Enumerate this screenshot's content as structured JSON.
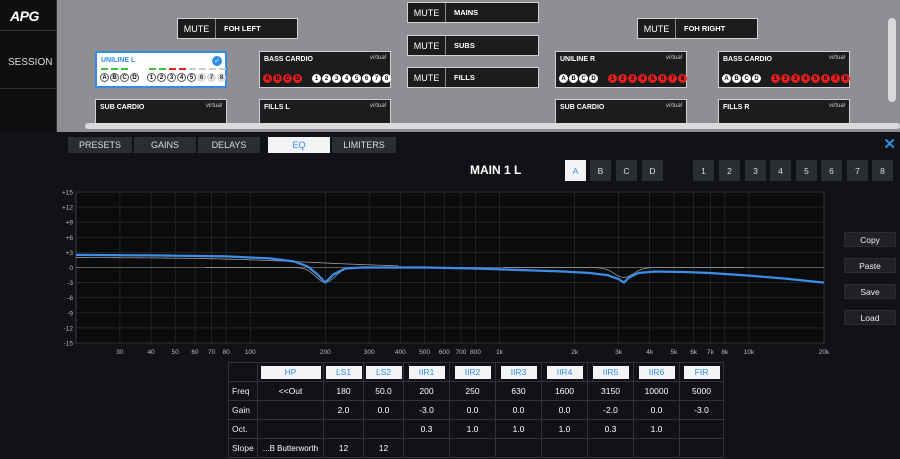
{
  "app": {
    "logo": "APG",
    "session": "SESSION"
  },
  "patch": {
    "mutes": [
      {
        "mute": "MUTE",
        "name": "FOH LEFT"
      },
      {
        "mute": "MUTE",
        "name": "MAINS"
      },
      {
        "mute": "MUTE",
        "name": "SUBS"
      },
      {
        "mute": "MUTE",
        "name": "FILLS"
      },
      {
        "mute": "MUTE",
        "name": "FOH RIGHT"
      }
    ],
    "channels": [
      {
        "title": "UNILINE L",
        "virtual": "",
        "selected": true
      },
      {
        "title": "BASS CARDIO",
        "virtual": "virtual"
      },
      {
        "title": "UNILINE R",
        "virtual": "virtual"
      },
      {
        "title": "BASS CARDIO",
        "virtual": "virtual"
      },
      {
        "title": "SUB CARDIO",
        "virtual": "virtual"
      },
      {
        "title": "FILLS L",
        "virtual": "virtual"
      },
      {
        "title": "SUB CARDIO",
        "virtual": "virtual"
      },
      {
        "title": "FILLS R",
        "virtual": "virtual"
      }
    ],
    "abcd": [
      "A",
      "B",
      "C",
      "D"
    ],
    "nums": [
      "1",
      "2",
      "3",
      "4",
      "5",
      "6",
      "7",
      "8"
    ]
  },
  "tabs": [
    "PRESETS",
    "GAINS",
    "DELAYS",
    "EQ",
    "LIMITERS"
  ],
  "active_tab": "EQ",
  "eq": {
    "title": "MAIN 1 L",
    "presets": [
      "A",
      "B",
      "C",
      "D"
    ],
    "active_preset": "A",
    "outputs": [
      "1",
      "2",
      "3",
      "4",
      "5",
      "6",
      "7",
      "8"
    ],
    "side_buttons": [
      "Copy",
      "Paste",
      "Save",
      "Load"
    ]
  },
  "chart_data": {
    "type": "line",
    "x_scale": "log",
    "xlim": [
      20,
      20000
    ],
    "ylim": [
      -15,
      15
    ],
    "y_ticks": [
      "+15",
      "+12",
      "+9",
      "+6",
      "+3",
      "0",
      "-3",
      "-6",
      "-9",
      "-12",
      "-15"
    ],
    "x_ticks": [
      30,
      40,
      50,
      60,
      70,
      80,
      100,
      200,
      300,
      400,
      500,
      600,
      700,
      800,
      1000,
      2000,
      3000,
      4000,
      5000,
      6000,
      7000,
      8000,
      10000,
      20000
    ],
    "x_tick_labels": [
      "30",
      "40",
      "50",
      "60",
      "70",
      "80",
      "100",
      "200",
      "300",
      "400",
      "500",
      "600",
      "700",
      "800",
      "1k",
      "2k",
      "3k",
      "4k",
      "5k",
      "6k",
      "7k",
      "8k",
      "10k",
      "20k"
    ],
    "grid": true,
    "colors": {
      "curve": "#3d8ee8",
      "bands": "#9a9a9a",
      "bg": "#0a0b0c"
    },
    "series": [
      {
        "x": [
          20,
          40,
          80,
          120,
          150,
          170,
          185,
          200,
          215,
          240,
          280,
          350,
          500,
          800,
          1200,
          1800,
          2300,
          2700,
          3000,
          3150,
          3300,
          3600,
          4200,
          5500,
          7000,
          10000,
          14000,
          20000
        ],
        "y": [
          2.5,
          2.4,
          2.2,
          1.8,
          1.2,
          0.2,
          -1.3,
          -3.0,
          -1.4,
          -0.2,
          0.0,
          0.0,
          0.0,
          -0.2,
          -0.5,
          -0.8,
          -1.1,
          -1.5,
          -2.3,
          -3.0,
          -2.0,
          -1.1,
          -0.8,
          -0.9,
          -1.1,
          -1.6,
          -2.2,
          -3.0
        ]
      }
    ]
  },
  "filter_table": {
    "headers": [
      "HP",
      "LS1",
      "LS2",
      "IIR1",
      "IIR2",
      "IIR3",
      "IIR4",
      "IIR5",
      "IIR6",
      "FIR"
    ],
    "rows": [
      {
        "label": "Freq",
        "cells": [
          "<<Out",
          "180",
          "50.0",
          "200",
          "250",
          "630",
          "1600",
          "3150",
          "10000",
          "5000"
        ]
      },
      {
        "label": "Gain",
        "cells": [
          "",
          "2.0",
          "0.0",
          "-3.0",
          "0.0",
          "0.0",
          "0.0",
          "-2.0",
          "0.0",
          "-3.0"
        ]
      },
      {
        "label": "Oct.",
        "cells": [
          "",
          "",
          "",
          "0.3",
          "1.0",
          "1.0",
          "1.0",
          "0.3",
          "1.0",
          ""
        ]
      },
      {
        "label": "Slope",
        "cells": [
          "...B Butterworth",
          "12",
          "12",
          "",
          "",
          "",
          "",
          "",
          "",
          ""
        ]
      }
    ]
  }
}
